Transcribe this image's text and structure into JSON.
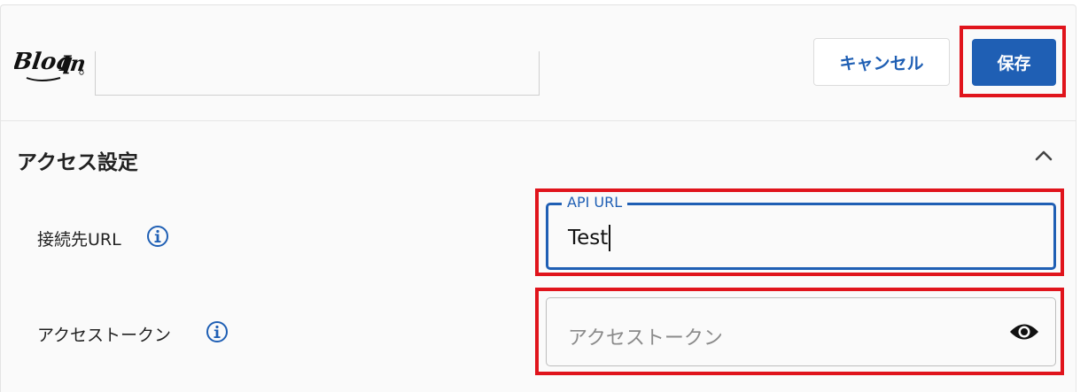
{
  "header": {
    "logo_text": "BlogIn",
    "cancel_label": "キャンセル",
    "save_label": "保存"
  },
  "section": {
    "title": "アクセス設定",
    "collapse_icon": "chevron-up-icon"
  },
  "fields": {
    "api_url": {
      "label": "接続先URL",
      "legend": "API URL",
      "value": "Test",
      "info_icon": "info-icon"
    },
    "access_token": {
      "label": "アクセストークン",
      "placeholder": "アクセストークン",
      "value": "",
      "info_icon": "info-icon",
      "visibility_icon": "eye-icon"
    }
  },
  "colors": {
    "accent": "#1f5fb4",
    "highlight": "#e0141c"
  }
}
